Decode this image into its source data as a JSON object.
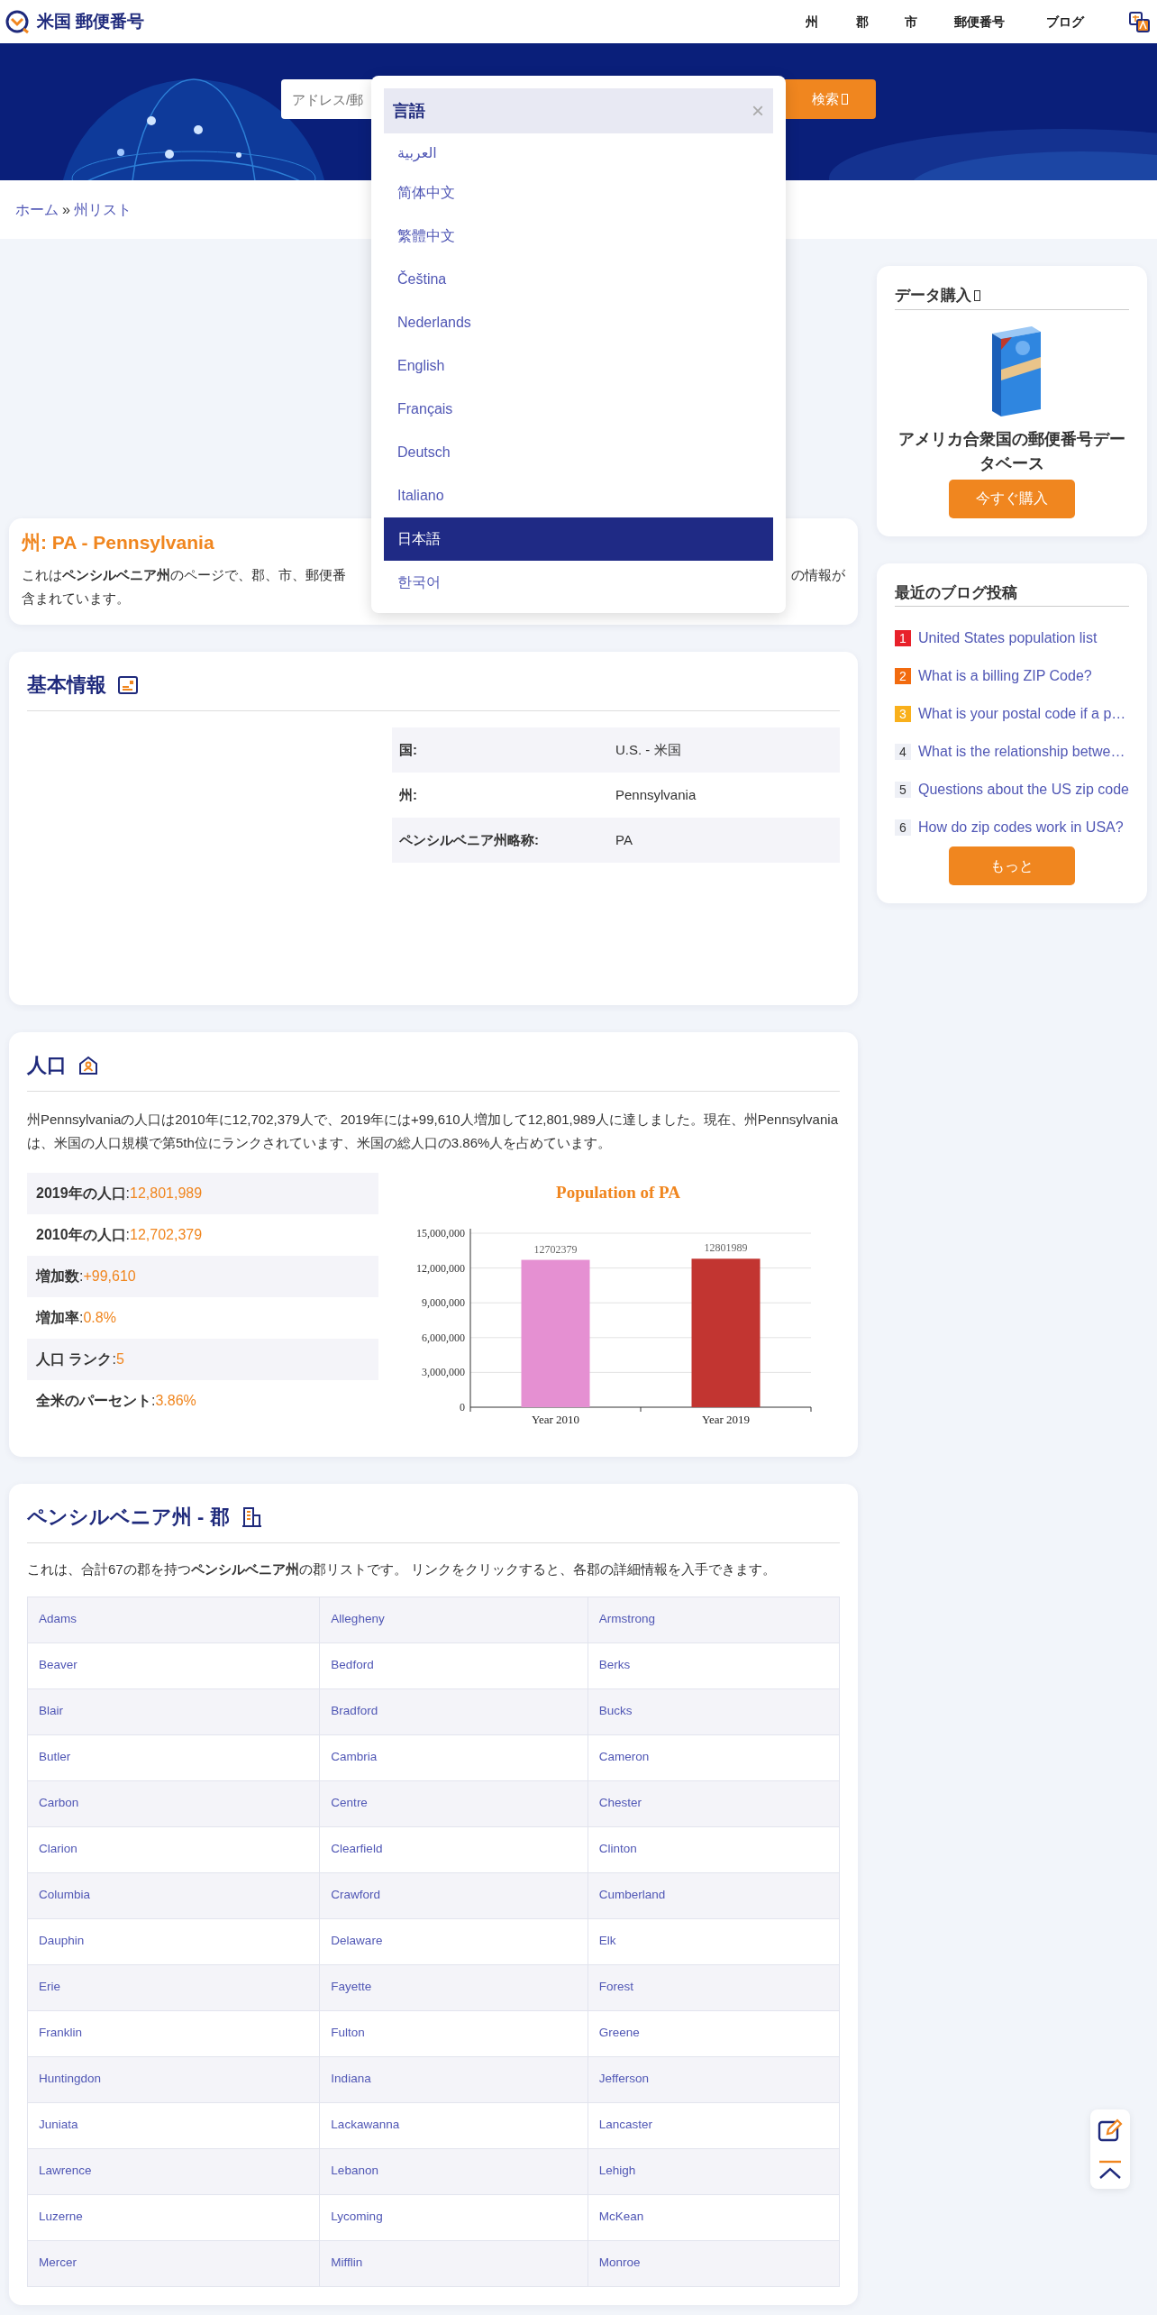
{
  "header": {
    "brand": "米国 郵便番号",
    "nav": [
      "州",
      "郡",
      "市",
      "郵便番号",
      "ブログ"
    ]
  },
  "search": {
    "placeholder": "アドレス/郵",
    "button": "検索"
  },
  "breadcrumb": {
    "items": [
      "ホーム",
      "州リスト"
    ],
    "separator": "»"
  },
  "language_menu": {
    "title": "言語",
    "close": "×",
    "items": [
      {
        "label": "العربية",
        "selected": false
      },
      {
        "label": "简体中文",
        "selected": false
      },
      {
        "label": "繁體中文",
        "selected": false
      },
      {
        "label": "Čeština",
        "selected": false
      },
      {
        "label": "Nederlands",
        "selected": false
      },
      {
        "label": "English",
        "selected": false
      },
      {
        "label": "Français",
        "selected": false
      },
      {
        "label": "Deutsch",
        "selected": false
      },
      {
        "label": "Italiano",
        "selected": false
      },
      {
        "label": "日本語",
        "selected": true
      },
      {
        "label": "한국어",
        "selected": false
      }
    ]
  },
  "state_card": {
    "title": "州: PA - Pennsylvania",
    "intro_left": "これは**ペンシルベニア州**のページで、郡、市、郵便番",
    "intro_right": "の情報が",
    "intro_line2": "含まれています。"
  },
  "basic_info": {
    "title": "基本情報",
    "rows": [
      {
        "label": "国:",
        "value": "U.S. - 米国"
      },
      {
        "label": "州:",
        "value": "Pennsylvania"
      },
      {
        "label": "ペンシルベニア州略称:",
        "value": "PA"
      }
    ]
  },
  "population": {
    "title": "人口",
    "text": "州Pennsylvaniaの人口は2010年に12,702,379人で、2019年には+99,610人増加して12,801,989人に達しました。現在、州Pennsylvaniaは、米国の人口規模で第5th位にランクされています、米国の総人口の3.86%人を占めています。",
    "stats": [
      {
        "label": "**2019年の人口**:",
        "value": "12,801,989"
      },
      {
        "label": "**2010年の人口**:",
        "value": "12,702,379"
      },
      {
        "label": "**増加数**:",
        "value": "+99,610"
      },
      {
        "label": "**増加率**:",
        "value": "0.8%"
      },
      {
        "label": "**人口 ランク**:",
        "value": "5"
      },
      {
        "label": "**全米のパーセント**:",
        "value": "3.86%"
      }
    ],
    "chart_data": {
      "type": "bar",
      "title": "Population of PA",
      "categories": [
        "Year 2010",
        "Year 2019"
      ],
      "stacked": true,
      "grid": true,
      "data_labels": true,
      "ylim": [
        0,
        15000000
      ],
      "yticks": [
        {
          "value": 0,
          "label": "0"
        },
        {
          "value": 3000000,
          "label": "3,000,000"
        },
        {
          "value": 6000000,
          "label": "6,000,000"
        },
        {
          "value": 9000000,
          "label": "9,000,000"
        },
        {
          "value": 12000000,
          "label": "12,000,000"
        },
        {
          "value": 15000000,
          "label": "15,000,000"
        }
      ],
      "series": [
        {
          "color": "#e590d2",
          "values": [
            12702379,
            null
          ]
        },
        {
          "color": "#c23531",
          "values": [
            null,
            12801989
          ]
        }
      ]
    }
  },
  "counties": {
    "title": "ペンシルベニア州 - 郡",
    "text": "これは、合計67の郡を持つ**ペンシルベニア州**の郡リストです。 リンクをクリックすると、各郡の詳細情報を入手できます。",
    "rows": [
      [
        "Adams",
        "Allegheny",
        "Armstrong"
      ],
      [
        "Beaver",
        "Bedford",
        "Berks"
      ],
      [
        "Blair",
        "Bradford",
        "Bucks"
      ],
      [
        "Butler",
        "Cambria",
        "Cameron"
      ],
      [
        "Carbon",
        "Centre",
        "Chester"
      ],
      [
        "Clarion",
        "Clearfield",
        "Clinton"
      ],
      [
        "Columbia",
        "Crawford",
        "Cumberland"
      ],
      [
        "Dauphin",
        "Delaware",
        "Elk"
      ],
      [
        "Erie",
        "Fayette",
        "Forest"
      ],
      [
        "Franklin",
        "Fulton",
        "Greene"
      ],
      [
        "Huntingdon",
        "Indiana",
        "Jefferson"
      ],
      [
        "Juniata",
        "Lackawanna",
        "Lancaster"
      ],
      [
        "Lawrence",
        "Lebanon",
        "Lehigh"
      ],
      [
        "Luzerne",
        "Lycoming",
        "McKean"
      ],
      [
        "Mercer",
        "Mifflin",
        "Monroe"
      ]
    ]
  },
  "purchase": {
    "title": "データ購入",
    "product": "アメリカ合衆国の郵便番号データベース",
    "button": "今すぐ購入"
  },
  "blog": {
    "title": "最近のブログ投稿",
    "button": "もっと",
    "posts": [
      {
        "rank": "1",
        "color": "#e8212a",
        "title": "United States population list"
      },
      {
        "rank": "2",
        "color": "#f26b0f",
        "title": "What is a billing ZIP Code?"
      },
      {
        "rank": "3",
        "color": "#f9b01b",
        "title": "What is your postal code if a p…"
      },
      {
        "rank": "4",
        "color": "#eef0f6",
        "title": "What is the relationship betwe…"
      },
      {
        "rank": "5",
        "color": "#eef0f6",
        "title": "Questions about the US zip code"
      },
      {
        "rank": "6",
        "color": "#eef0f6",
        "title": "How do zip codes work in USA?"
      }
    ]
  }
}
